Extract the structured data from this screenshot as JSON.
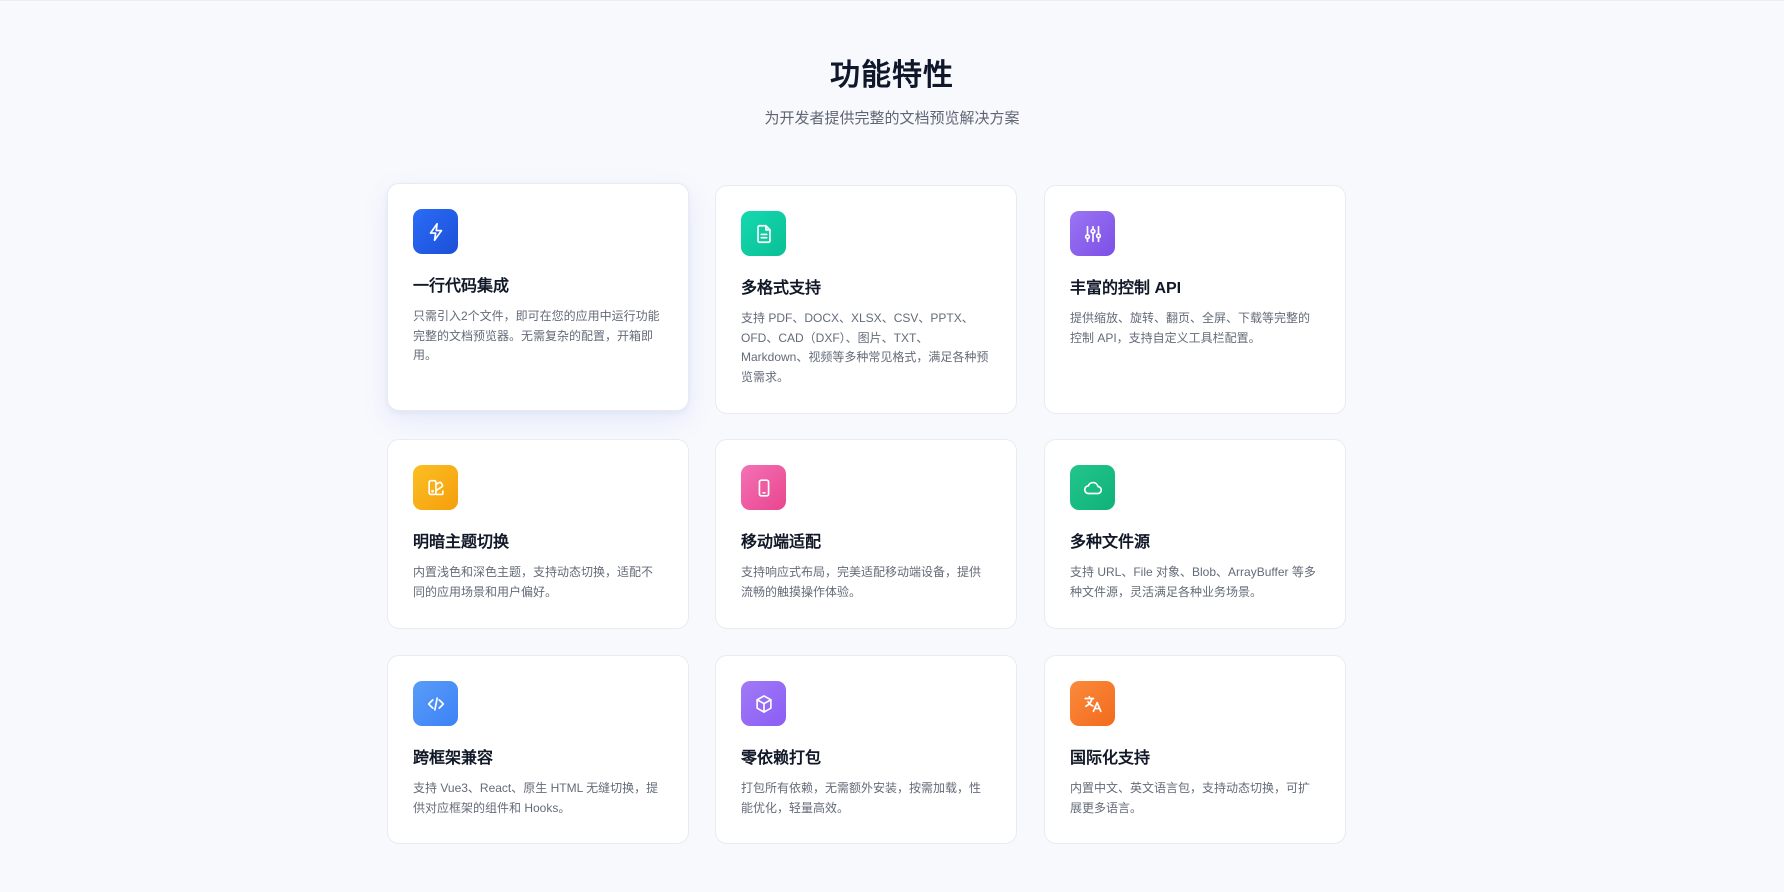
{
  "section": {
    "title": "功能特性",
    "subtitle": "为开发者提供完整的文档预览解决方案"
  },
  "features": [
    {
      "title": "一行代码集成",
      "description": "只需引入2个文件，即可在您的应用中运行功能完整的文档预览器。无需复杂的配置，开箱即用。",
      "icon": "bolt-icon",
      "color_from": "#2a6cf6",
      "color_to": "#1d4fd8"
    },
    {
      "title": "多格式支持",
      "description": "支持 PDF、DOCX、XLSX、CSV、PPTX、OFD、CAD（DXF）、图片、TXT、Markdown、视频等多种常见格式，满足各种预览需求。",
      "icon": "document-icon",
      "color_from": "#14d9b0",
      "color_to": "#0bbf95"
    },
    {
      "title": "丰富的控制 API",
      "description": "提供缩放、旋转、翻页、全屏、下载等完整的控制 API，支持自定义工具栏配置。",
      "icon": "sliders-icon",
      "color_from": "#9a75f3",
      "color_to": "#7c4fe6"
    },
    {
      "title": "明暗主题切换",
      "description": "内置浅色和深色主题，支持动态切换，适配不同的应用场景和用户偏好。",
      "icon": "palette-icon",
      "color_from": "#fbbf24",
      "color_to": "#f59e0b"
    },
    {
      "title": "移动端适配",
      "description": "支持响应式布局，完美适配移动端设备，提供流畅的触摸操作体验。",
      "icon": "mobile-icon",
      "color_from": "#f472b6",
      "color_to": "#e8458e"
    },
    {
      "title": "多种文件源",
      "description": "支持 URL、File 对象、Blob、ArrayBuffer 等多种文件源，灵活满足各种业务场景。",
      "icon": "cloud-icon",
      "color_from": "#22c58b",
      "color_to": "#10b27a"
    },
    {
      "title": "跨框架兼容",
      "description": "支持 Vue3、React、原生 HTML 无缝切换，提供对应框架的组件和 Hooks。",
      "icon": "code-icon",
      "color_from": "#5b9cf8",
      "color_to": "#3b82f6"
    },
    {
      "title": "零依赖打包",
      "description": "打包所有依赖，无需额外安装，按需加载，性能优化，轻量高效。",
      "icon": "package-icon",
      "color_from": "#a07bf5",
      "color_to": "#8b5cf6"
    },
    {
      "title": "国际化支持",
      "description": "内置中文、英文语言包，支持动态切换，可扩展更多语言。",
      "icon": "translate-icon",
      "color_from": "#fb8a3c",
      "color_to": "#f26b1d"
    }
  ]
}
